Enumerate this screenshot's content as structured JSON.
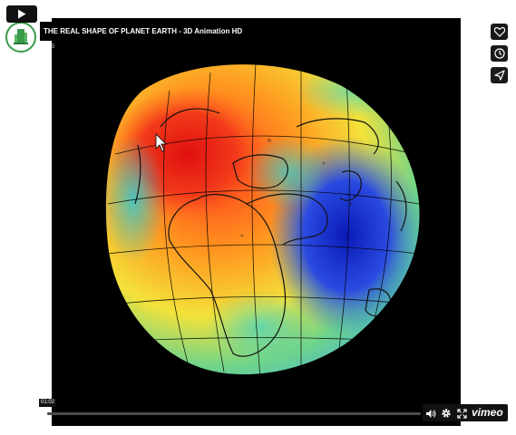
{
  "video": {
    "title": "THE REAL SHAPE OF PLANET EARTH - 3D Animation HD",
    "subtitle_mark": "5"
  },
  "side_actions": {
    "like_icon": "heart-icon",
    "watch_later_icon": "clock-icon",
    "share_icon": "send-icon"
  },
  "controls": {
    "time_tooltip": "01:02",
    "progress": 0.0,
    "play_icon": "play-icon",
    "volume_icon": "volume-icon",
    "settings_icon": "gear-icon",
    "fullscreen_icon": "fullscreen-icon",
    "brand": "vimeo"
  },
  "colors": {
    "frame_bg": "#000000",
    "chip_bg": "#111111",
    "page_bg": "#ffffff"
  }
}
